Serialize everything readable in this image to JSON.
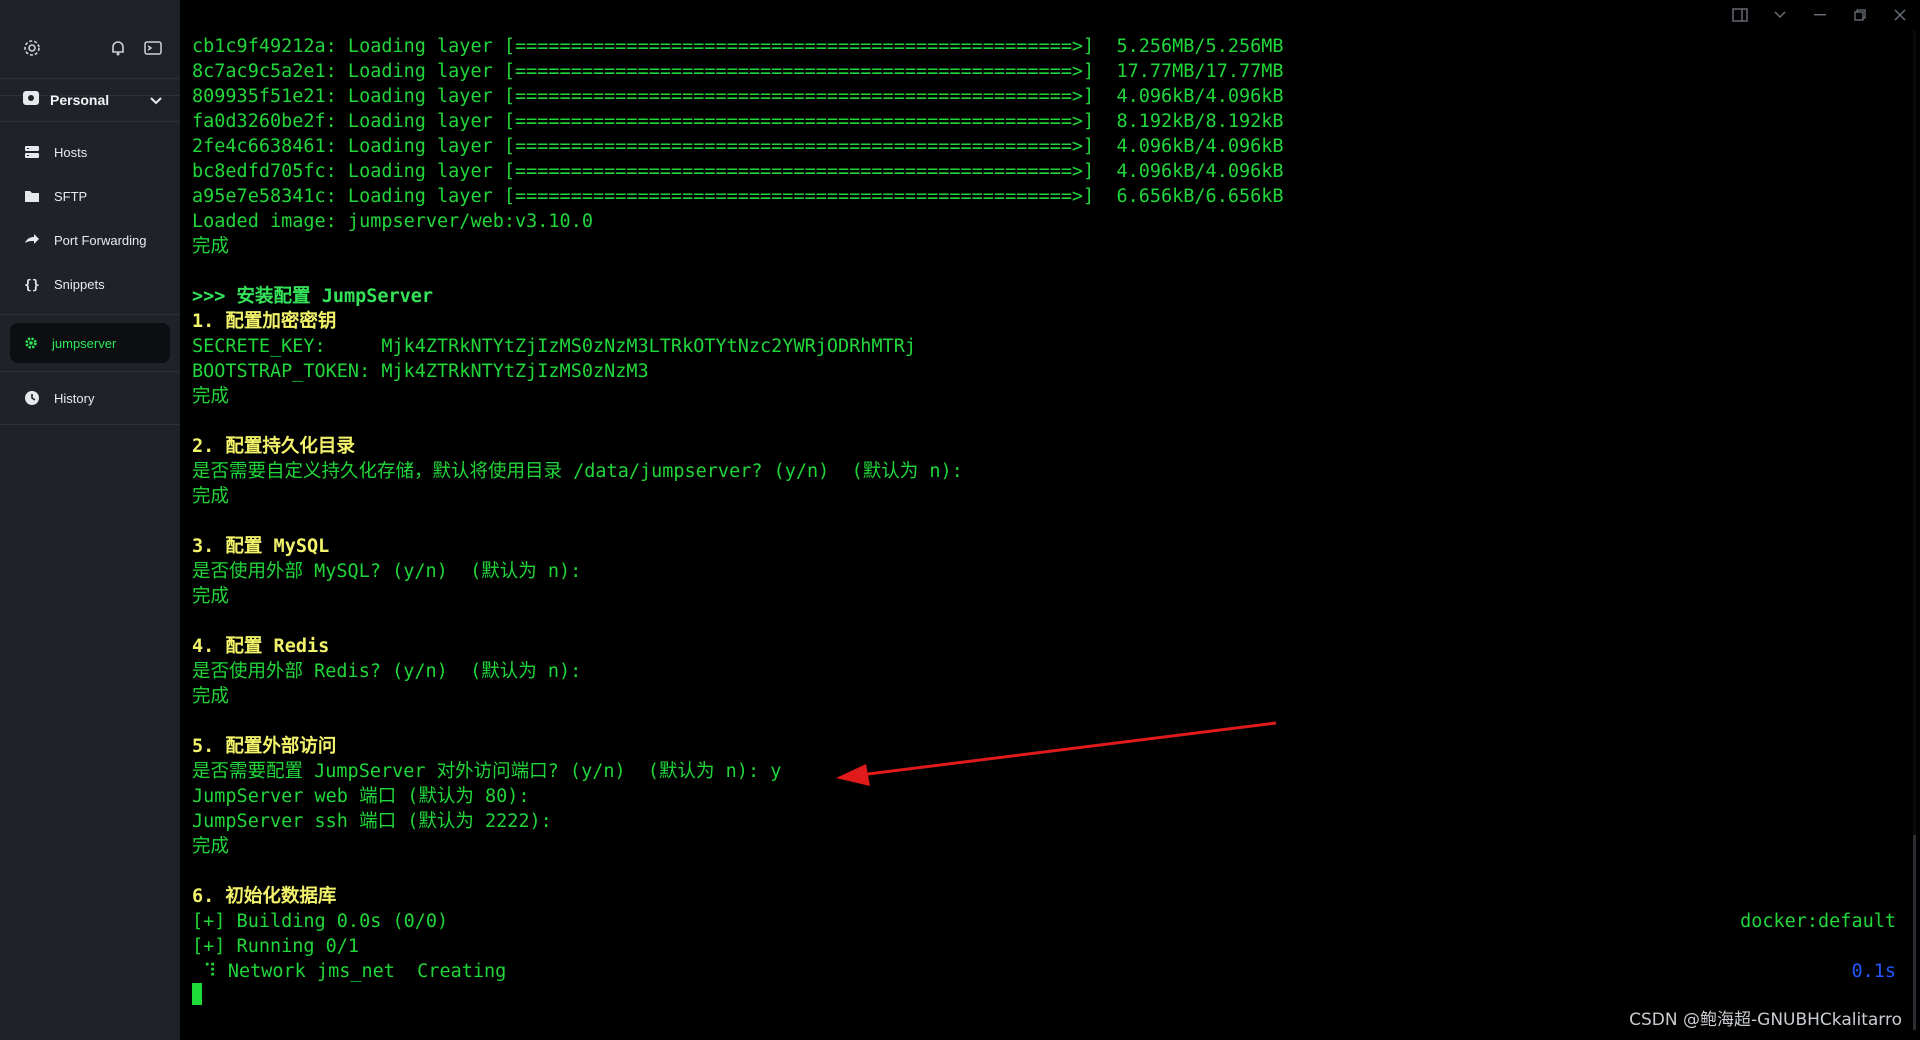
{
  "sidebar": {
    "vault_label": "Personal",
    "nav": [
      {
        "label": "Hosts",
        "icon": "hosts-icon"
      },
      {
        "label": "SFTP",
        "icon": "folder-icon"
      },
      {
        "label": "Port Forwarding",
        "icon": "forward-arrow-icon"
      },
      {
        "label": "Snippets",
        "icon": "braces-icon"
      }
    ],
    "session_label": "jumpserver",
    "history_label": "History"
  },
  "terminal": {
    "lines": [
      {
        "text": "cb1c9f49212a: Loading layer [==================================================>]  5.256MB/5.256MB",
        "style": "normal"
      },
      {
        "text": "8c7ac9c5a2e1: Loading layer [==================================================>]  17.77MB/17.77MB",
        "style": "normal"
      },
      {
        "text": "809935f51e21: Loading layer [==================================================>]  4.096kB/4.096kB",
        "style": "normal"
      },
      {
        "text": "fa0d3260be2f: Loading layer [==================================================>]  8.192kB/8.192kB",
        "style": "normal"
      },
      {
        "text": "2fe4c6638461: Loading layer [==================================================>]  4.096kB/4.096kB",
        "style": "normal"
      },
      {
        "text": "bc8edfd705fc: Loading layer [==================================================>]  4.096kB/4.096kB",
        "style": "normal"
      },
      {
        "text": "a95e7e58341c: Loading layer [==================================================>]  6.656kB/6.656kB",
        "style": "normal"
      },
      {
        "text": "Loaded image: jumpserver/web:v3.10.0",
        "style": "normal"
      },
      {
        "text": "完成",
        "style": "normal"
      },
      {
        "text": "",
        "style": "normal"
      },
      {
        "text": ">>> 安装配置 JumpServer",
        "style": "hdr"
      },
      {
        "text": "1. 配置加密密钥",
        "style": "bold"
      },
      {
        "text": "SECRETE_KEY:     Mjk4ZTRkNTYtZjIzMS0zNzM3LTRkOTYtNzc2YWRjODRhMTRj",
        "style": "normal"
      },
      {
        "text": "BOOTSTRAP_TOKEN: Mjk4ZTRkNTYtZjIzMS0zNzM3",
        "style": "normal"
      },
      {
        "text": "完成",
        "style": "normal"
      },
      {
        "text": "",
        "style": "normal"
      },
      {
        "text": "2. 配置持久化目录",
        "style": "bold"
      },
      {
        "text": "是否需要自定义持久化存储，默认将使用目录 /data/jumpserver? (y/n)  (默认为 n):",
        "style": "normal"
      },
      {
        "text": "完成",
        "style": "normal"
      },
      {
        "text": "",
        "style": "normal"
      },
      {
        "text": "3. 配置 MySQL",
        "style": "bold"
      },
      {
        "text": "是否使用外部 MySQL? (y/n)  (默认为 n):",
        "style": "normal"
      },
      {
        "text": "完成",
        "style": "normal"
      },
      {
        "text": "",
        "style": "normal"
      },
      {
        "text": "4. 配置 Redis",
        "style": "bold"
      },
      {
        "text": "是否使用外部 Redis? (y/n)  (默认为 n):",
        "style": "normal"
      },
      {
        "text": "完成",
        "style": "normal"
      },
      {
        "text": "",
        "style": "normal"
      },
      {
        "text": "5. 配置外部访问",
        "style": "bold"
      },
      {
        "text": "是否需要配置 JumpServer 对外访问端口? (y/n)  (默认为 n): y",
        "style": "normal"
      },
      {
        "text": "JumpServer web 端口 (默认为 80):",
        "style": "normal"
      },
      {
        "text": "JumpServer ssh 端口 (默认为 2222):",
        "style": "normal"
      },
      {
        "text": "完成",
        "style": "normal"
      },
      {
        "text": "",
        "style": "normal"
      },
      {
        "text": "6. 初始化数据库",
        "style": "bold"
      },
      {
        "text": "[+] Building 0.0s (0/0)",
        "style": "normal"
      },
      {
        "text": "[+] Running 0/1",
        "style": "normal"
      },
      {
        "text": " ⠹ Network jms_net  Creating",
        "style": "normal"
      }
    ],
    "right_status_1": "docker:default",
    "right_status_2": "0.1s",
    "colors": {
      "green": "#21d63a",
      "yellow": "#f3f36b",
      "blue": "#2456ff",
      "arrow": "#e11b1b"
    }
  },
  "watermark": "CSDN @鲍海超-GNUBHCkalitarro"
}
